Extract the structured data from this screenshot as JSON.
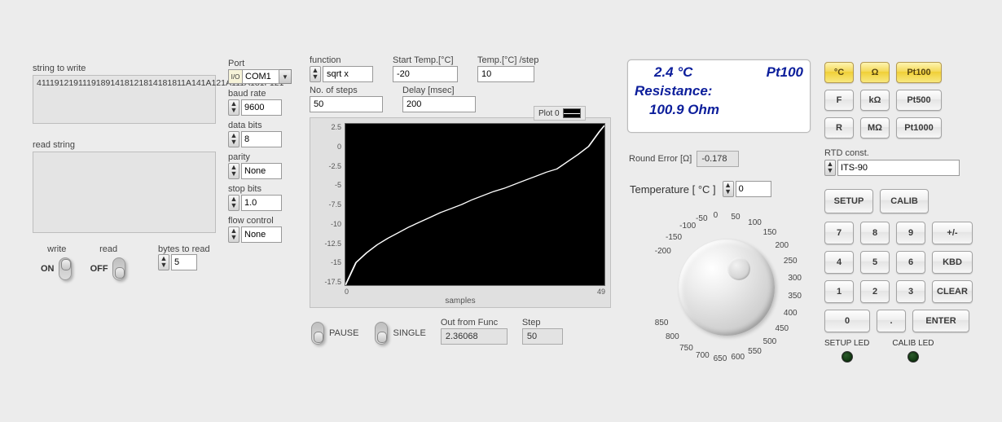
{
  "serial": {
    "string_to_write_label": "string to write",
    "string_to_write": "41119121911191891418121814181811A141A121A111A181F121",
    "read_string_label": "read string",
    "read_string": "",
    "write_label": "write",
    "read_label": "read",
    "write_state": "ON",
    "read_state": "OFF",
    "bytes_label": "bytes to read",
    "bytes_value": "5"
  },
  "port": {
    "port_label": "Port",
    "port_value": "COM1",
    "baud_label": "baud rate",
    "baud_value": "9600",
    "data_label": "data bits",
    "data_value": "8",
    "parity_label": "parity",
    "parity_value": "None",
    "stop_label": "stop bits",
    "stop_value": "1.0",
    "flow_label": "flow control",
    "flow_value": "None"
  },
  "func": {
    "function_label": "function",
    "function_value": "sqrt x",
    "start_label": "Start Temp.[°C]",
    "start_value": "-20",
    "step_label": "Temp.[°C] /step",
    "step_value": "10",
    "nsteps_label": "No. of steps",
    "nsteps_value": "50",
    "delay_label": "Delay [msec]",
    "delay_value": "200",
    "plot_legend": "Plot 0",
    "pause_label": "PAUSE",
    "single_label": "SINGLE",
    "out_label": "Out from Func",
    "out_value": "2.36068",
    "stepno_label": "Step",
    "stepno_value": "50",
    "xaxis": "samples"
  },
  "display": {
    "temp": "2.4 °C",
    "rtd_type": "Pt100",
    "line2": "Resistance:",
    "value": "100.9  Ohm"
  },
  "round_err": {
    "label": "Round Error [Ω]",
    "value": "-0.178"
  },
  "gauge": {
    "title": "Temperature  [ °C ]",
    "spin_value": "0",
    "ticks": [
      "-200",
      "-150",
      "-100",
      "-50",
      "0",
      "50",
      "100",
      "150",
      "200",
      "250",
      "300",
      "350",
      "400",
      "450",
      "500",
      "550",
      "600",
      "650",
      "700",
      "750",
      "800",
      "850"
    ]
  },
  "keys": {
    "row1": [
      "°C",
      "Ω",
      "Pt100"
    ],
    "row2": [
      "F",
      "kΩ",
      "Pt500"
    ],
    "row3": [
      "R",
      "MΩ",
      "Pt1000"
    ],
    "rtd_label": "RTD const.",
    "rtd_value": "ITS-90",
    "setup": "SETUP",
    "calib": "CALIB",
    "pad": [
      [
        "7",
        "8",
        "9",
        "+/-"
      ],
      [
        "4",
        "5",
        "6",
        "KBD"
      ],
      [
        "1",
        "2",
        "3",
        "CLEAR"
      ],
      [
        "0",
        ".",
        "ENTER"
      ]
    ],
    "led1": "SETUP LED",
    "led2": "CALIB LED"
  },
  "chart_data": {
    "type": "line",
    "title": "",
    "xlabel": "samples",
    "ylabel": "",
    "xlim": [
      0,
      49
    ],
    "ylim": [
      -17.5,
      2.5
    ],
    "yticks": [
      2.5,
      0,
      -2.5,
      -5,
      -7.5,
      -10,
      -12.5,
      -15,
      -17.5
    ],
    "xticks": [
      0,
      49
    ],
    "series": [
      {
        "name": "Plot 0",
        "x": [
          0,
          2,
          4,
          6,
          8,
          10,
          12,
          14,
          16,
          18,
          20,
          22,
          24,
          26,
          28,
          30,
          32,
          34,
          36,
          38,
          40,
          42,
          44,
          46,
          48,
          49
        ],
        "y": [
          -17.5,
          -14.7,
          -13.5,
          -12.5,
          -11.7,
          -11.0,
          -10.3,
          -9.7,
          -9.1,
          -8.5,
          -8.0,
          -7.5,
          -6.9,
          -6.4,
          -5.9,
          -5.5,
          -5.0,
          -4.5,
          -4.0,
          -3.5,
          -3.1,
          -2.2,
          -1.3,
          -0.3,
          1.5,
          2.3
        ]
      }
    ]
  }
}
